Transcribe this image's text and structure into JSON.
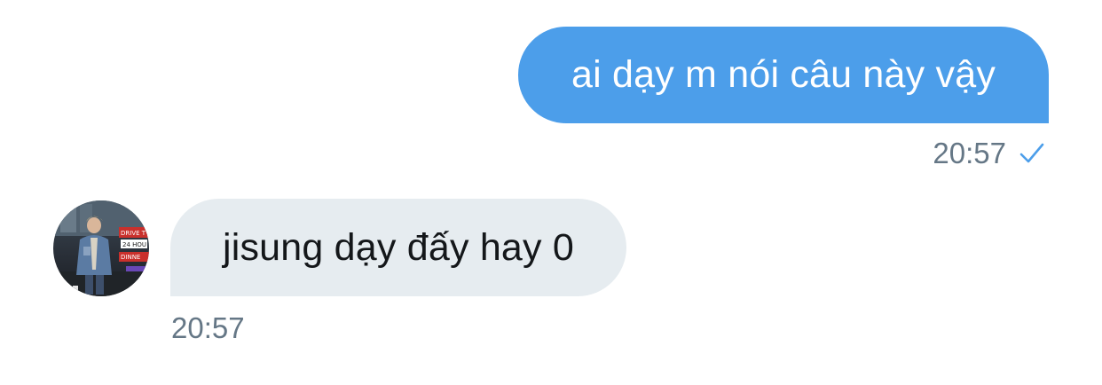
{
  "messages": [
    {
      "direction": "outgoing",
      "text": "ai dạy m nói câu này vậy",
      "time": "20:57",
      "status_icon": "check-icon"
    },
    {
      "direction": "incoming",
      "text": "jisung dạy đấy hay 0",
      "time": "20:57",
      "avatar": "avatar-photo"
    }
  ],
  "colors": {
    "outgoing_bubble": "#4c9eea",
    "incoming_bubble": "#e6ecf0",
    "timestamp": "#657786",
    "check": "#4c9eea"
  },
  "avatar_sign_text": [
    "DRIVE T",
    "24 HOU",
    "DINNE"
  ]
}
